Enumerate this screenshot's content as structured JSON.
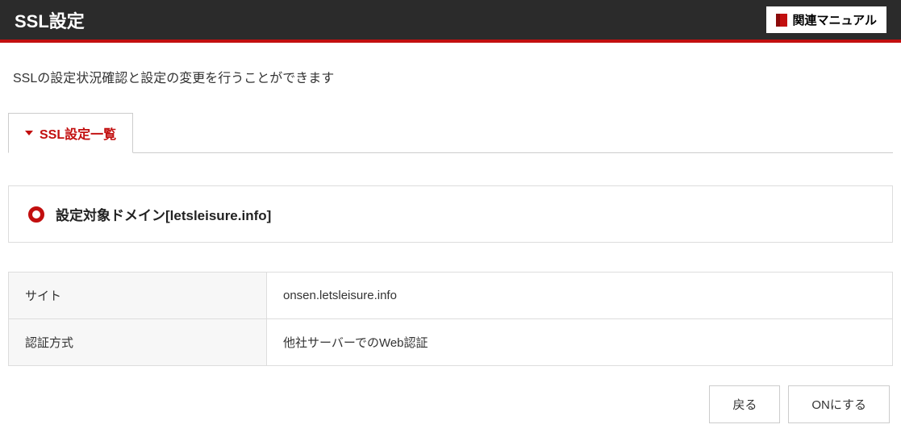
{
  "header": {
    "title": "SSL設定",
    "manual_button": "関連マニュアル"
  },
  "description": "SSLの設定状況確認と設定の変更を行うことができます",
  "tab": {
    "label": "SSL設定一覧"
  },
  "domain_panel": {
    "title": "設定対象ドメイン[letsleisure.info]"
  },
  "table": {
    "rows": [
      {
        "label": "サイト",
        "value": "onsen.letsleisure.info"
      },
      {
        "label": "認証方式",
        "value": "他社サーバーでのWeb認証"
      }
    ]
  },
  "buttons": {
    "back": "戻る",
    "enable": "ONにする"
  }
}
